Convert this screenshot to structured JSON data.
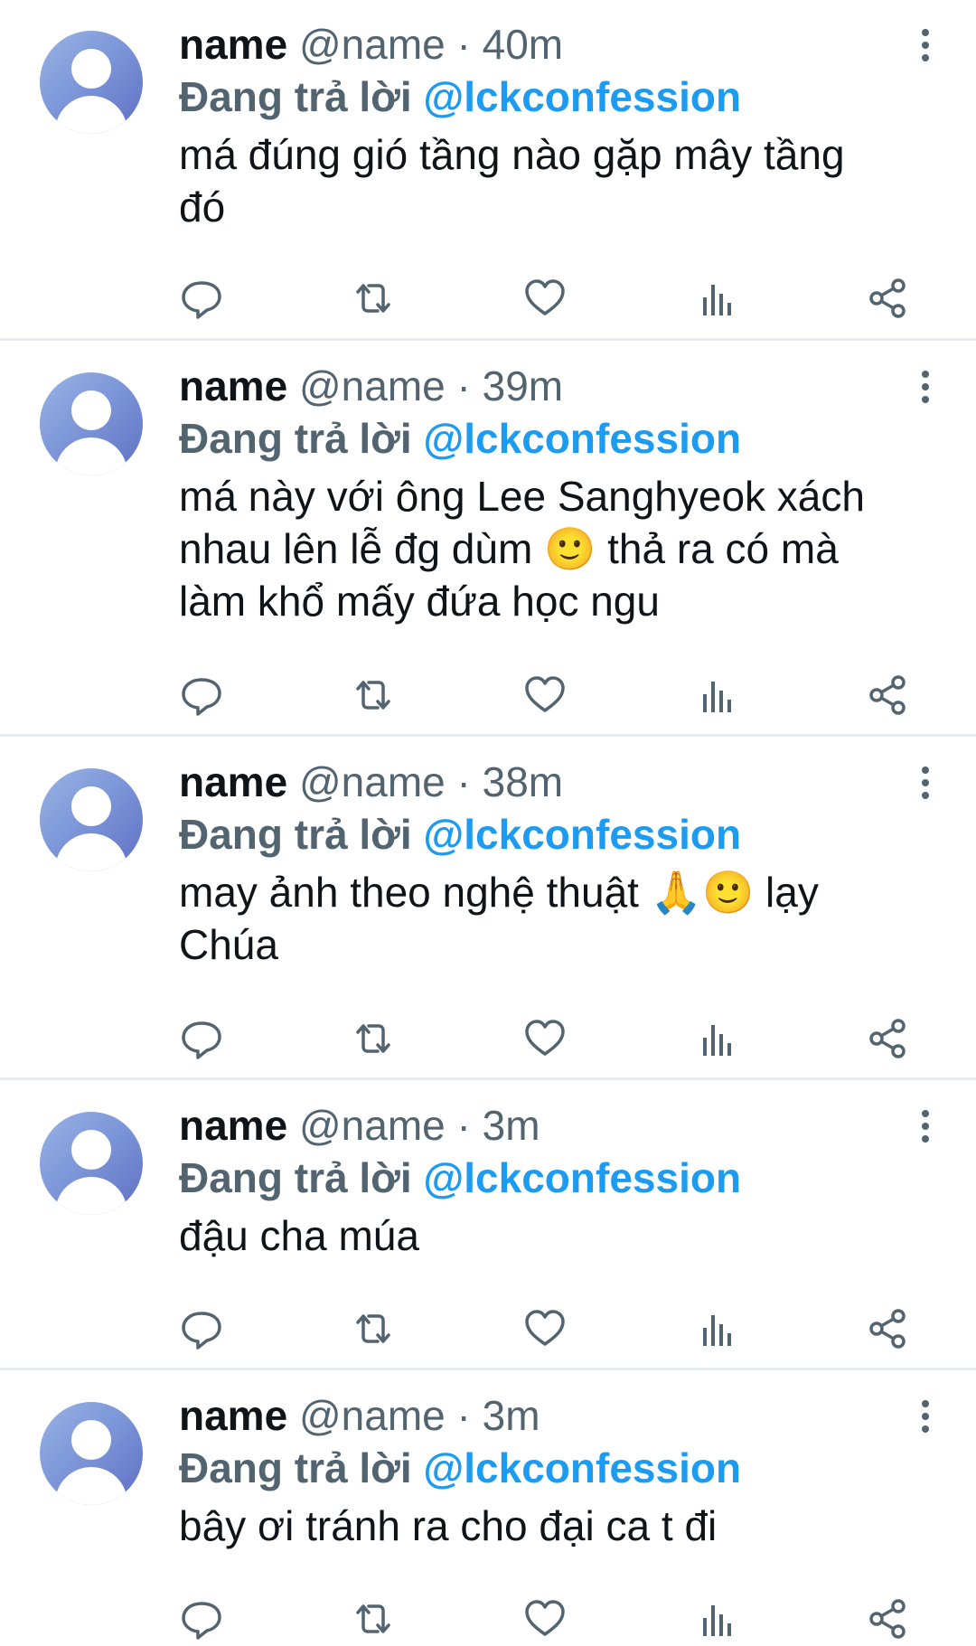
{
  "tweets": [
    {
      "display_name": "name",
      "handle": "@name",
      "separator": "·",
      "time": "40m",
      "reply_prefix": "Đang trả lời",
      "reply_to": "@lckconfession",
      "text_lines": [
        "má đúng gió tầng nào gặp mây tầng",
        "đó"
      ]
    },
    {
      "display_name": "name",
      "handle": "@name",
      "separator": "·",
      "time": "39m",
      "reply_prefix": "Đang trả lời",
      "reply_to": "@lckconfession",
      "text_lines": [
        "má này với ông Lee Sanghyeok xách",
        "nhau lên lễ đg dùm 🙂 thả ra có mà",
        "làm khổ mấy đứa học ngu"
      ]
    },
    {
      "display_name": "name",
      "handle": "@name",
      "separator": "·",
      "time": "38m",
      "reply_prefix": "Đang trả lời",
      "reply_to": "@lckconfession",
      "text_lines": [
        "may ảnh theo nghệ thuật 🙏🙂 lạy",
        "Chúa"
      ]
    },
    {
      "display_name": "name",
      "handle": "@name",
      "separator": "·",
      "time": "3m",
      "reply_prefix": "Đang trả lời",
      "reply_to": "@lckconfession",
      "text_lines": [
        "đậu cha múa"
      ]
    },
    {
      "display_name": "name",
      "handle": "@name",
      "separator": "·",
      "time": "3m",
      "reply_prefix": "Đang trả lời",
      "reply_to": "@lckconfession",
      "text_lines": [
        "bây ơi tránh ra cho đại ca t đi"
      ]
    }
  ],
  "icons": {
    "avatar": "default-avatar-icon",
    "more": "more-vertical-icon",
    "reply": "reply-icon",
    "retweet": "retweet-icon",
    "like": "heart-icon",
    "views": "analytics-icon",
    "share": "share-icon"
  },
  "colors": {
    "link": "#1d9bf0",
    "secondary_text": "#536471",
    "primary_text": "#0f1419",
    "divider": "#e6ecf0"
  }
}
